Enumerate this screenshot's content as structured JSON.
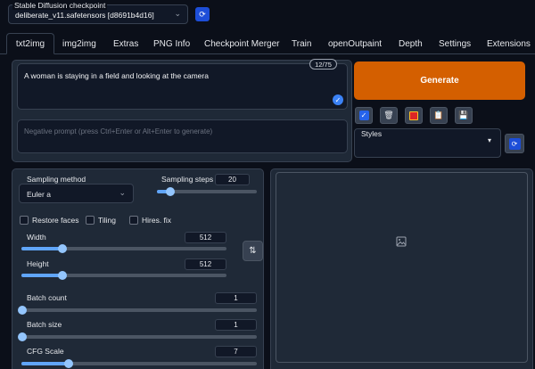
{
  "checkpoint": {
    "label": "Stable Diffusion checkpoint",
    "value": "deliberate_v11.safetensors [d8691b4d16]"
  },
  "tabs": [
    {
      "label": "txt2img",
      "active": true
    },
    {
      "label": "img2img"
    },
    {
      "label": "Extras"
    },
    {
      "label": "PNG Info"
    },
    {
      "label": "Checkpoint Merger"
    },
    {
      "label": "Train"
    },
    {
      "label": "openOutpaint"
    },
    {
      "label": "Depth"
    },
    {
      "label": "Settings"
    },
    {
      "label": "Extensions"
    }
  ],
  "prompt": {
    "text": "A woman is staying in a field and looking at the camera",
    "token_count": "12/75"
  },
  "negative_prompt": {
    "placeholder": "Negative prompt (press Ctrl+Enter or Alt+Enter to generate)"
  },
  "generate_label": "Generate",
  "styles": {
    "label": "Styles"
  },
  "sampling": {
    "method_label": "Sampling method",
    "method_value": "Euler a",
    "steps_label": "Sampling steps",
    "steps_value": "20",
    "steps_fraction": 0.13
  },
  "checkboxes": [
    {
      "label": "Restore faces",
      "checked": false
    },
    {
      "label": "Tiling",
      "checked": false
    },
    {
      "label": "Hires. fix",
      "checked": false
    }
  ],
  "width": {
    "label": "Width",
    "value": "512",
    "fraction": 0.2
  },
  "height": {
    "label": "Height",
    "value": "512",
    "fraction": 0.2
  },
  "batch_count": {
    "label": "Batch count",
    "value": "1",
    "fraction": 0.0
  },
  "batch_size": {
    "label": "Batch size",
    "value": "1",
    "fraction": 0.0
  },
  "cfg_scale": {
    "label": "CFG Scale",
    "value": "7",
    "fraction": 0.2
  },
  "colors": {
    "accent": "#d45f00",
    "slider": "#60a5fa",
    "background": "#0b0f19",
    "panel": "#1f2937"
  },
  "icons": {
    "checkpoint_refresh": "refresh-icon",
    "tools": [
      "checkbox-icon",
      "trash-icon",
      "red-square-icon",
      "clipboard-icon",
      "save-icon"
    ],
    "styles_refresh": "refresh-icon",
    "swap": "swap-arrows-icon",
    "output": "image-icon"
  }
}
